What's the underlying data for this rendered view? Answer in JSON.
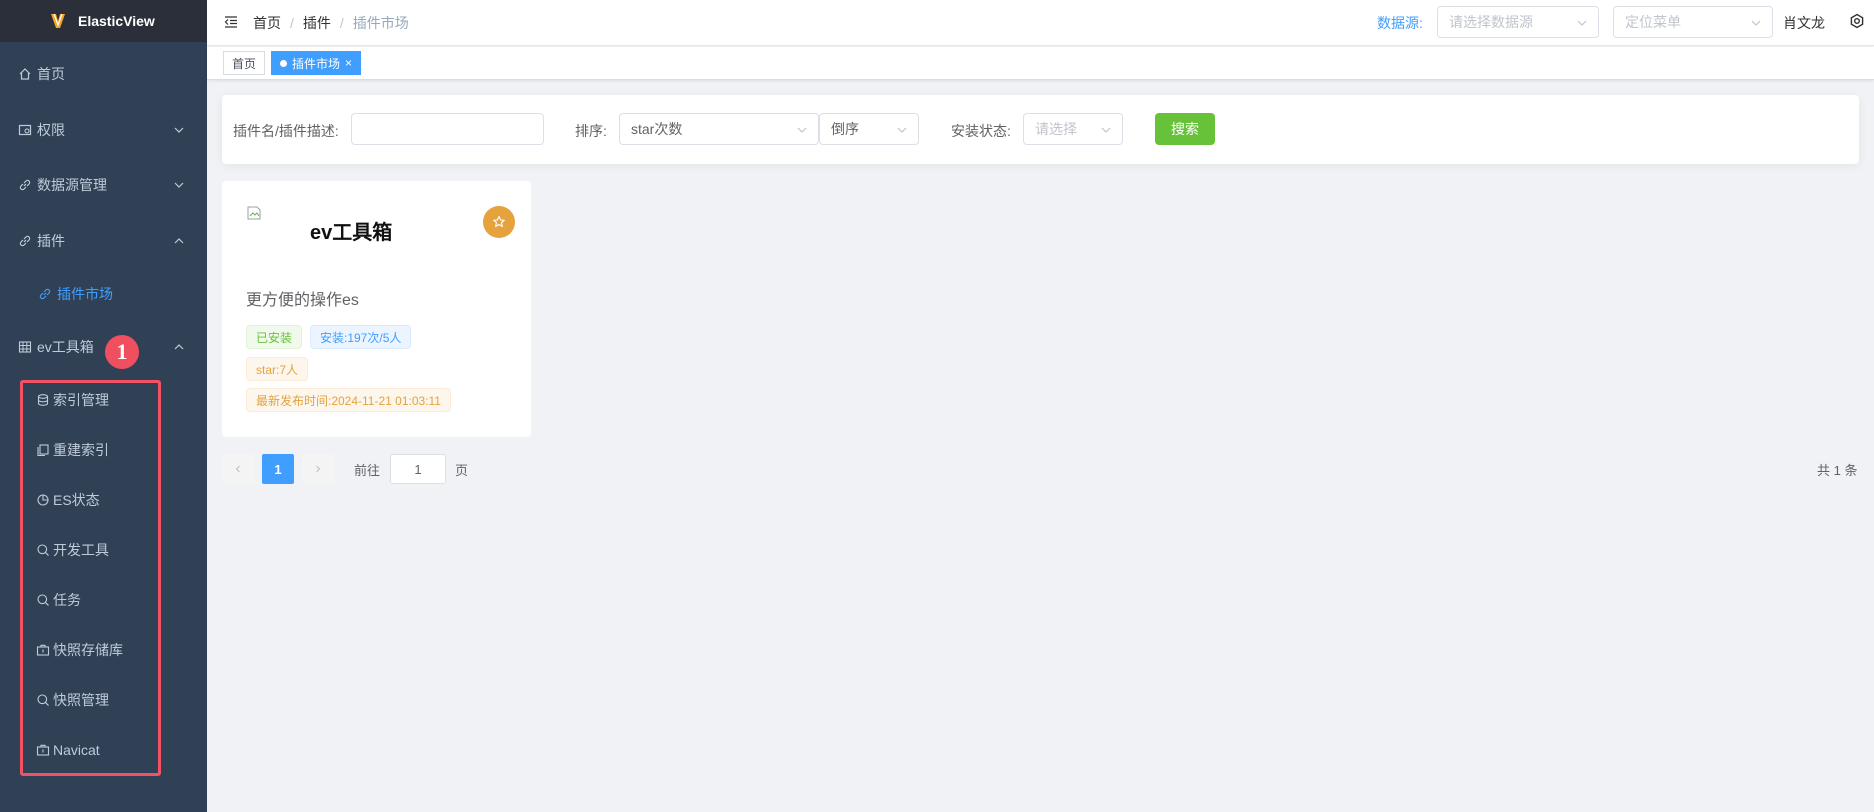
{
  "app": {
    "name": "ElasticView"
  },
  "sidebar": {
    "home": "首页",
    "permissions": "权限",
    "datasource_mgmt": "数据源管理",
    "plugins": "插件",
    "plugin_market": "插件市场",
    "ev_toolbox": "ev工具箱",
    "toolbox_items": [
      {
        "label": "索引管理",
        "icon": "database-icon"
      },
      {
        "label": "重建索引",
        "icon": "copy-icon"
      },
      {
        "label": "ES状态",
        "icon": "pie-chart-icon"
      },
      {
        "label": "开发工具",
        "icon": "search-icon"
      },
      {
        "label": "任务",
        "icon": "search-icon"
      },
      {
        "label": "快照存储库",
        "icon": "suitcase-icon"
      },
      {
        "label": "快照管理",
        "icon": "search-icon"
      },
      {
        "label": "Navicat",
        "icon": "suitcase-icon"
      }
    ],
    "annotation_number": "1"
  },
  "header": {
    "breadcrumb": [
      "首页",
      "插件",
      "插件市场"
    ],
    "datasource_label": "数据源:",
    "datasource_placeholder": "请选择数据源",
    "menu_locator_placeholder": "定位菜单",
    "user": "肖文龙"
  },
  "tags": {
    "home": "首页",
    "plugin_market": "插件市场",
    "close": "×"
  },
  "filter": {
    "name_label": "插件名/插件描述:",
    "name_value": "",
    "sort_label": "排序:",
    "sort_value": "star次数",
    "order_value": "倒序",
    "status_label": "安装状态:",
    "status_placeholder": "请选择",
    "search_button": "搜索"
  },
  "plugin_card": {
    "title": "ev工具箱",
    "description": "更方便的操作es",
    "tag_installed": "已安装",
    "tag_install_count": "安装:197次/5人",
    "tag_star": "star:7人",
    "tag_release_time": "最新发布时间:2024-11-21 01:03:11"
  },
  "pagination": {
    "current_page": "1",
    "goto_label": "前往",
    "goto_value": "1",
    "page_suffix": "页",
    "total": "共 1 条"
  },
  "colors": {
    "sidebar_bg": "#304156",
    "brand_bg": "#2b2f3a",
    "primary": "#409eff",
    "success": "#67c23a",
    "warning": "#e6a23c",
    "annotation": "#f25264"
  }
}
